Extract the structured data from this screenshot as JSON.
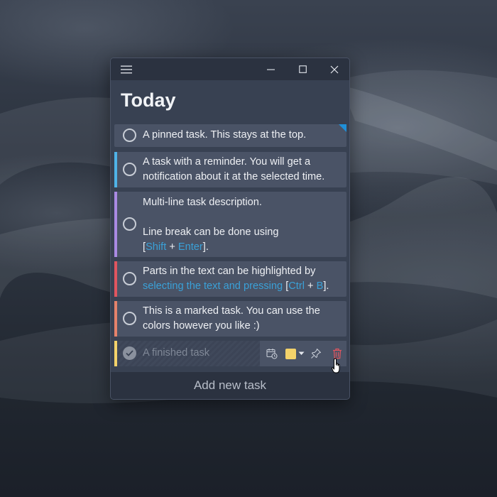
{
  "window": {
    "title": "Today",
    "add_task_label": "Add new task"
  },
  "tasks": [
    {
      "id": "pinned",
      "lines": [
        "A pinned task. This stays at the top."
      ],
      "pinned": true,
      "color": ""
    },
    {
      "id": "reminder",
      "lines": [
        "A task with a reminder. You will get a",
        "notification about it at the selected time."
      ],
      "color": "#4fb3e8"
    },
    {
      "id": "multiline",
      "line1": "Multi-line task description.",
      "line2": "Line break can be done using",
      "line3_open": "[",
      "line3_shift": "Shift",
      "line3_plus": " + ",
      "line3_enter": "Enter",
      "line3_close": "].",
      "color": "#a98ae3"
    },
    {
      "id": "highlight",
      "line1": "Parts in the text can be highlighted by",
      "line2_hl": "selecting the text and pressing",
      "line2_open": " [",
      "line2_ctrl": "Ctrl",
      "line2_plus": " + ",
      "line2_b": "B",
      "line2_close": "].",
      "color": "#e0555f"
    },
    {
      "id": "marked",
      "lines": [
        "This is a marked task. You can use the",
        "colors however you like :)"
      ],
      "color": "#e5826b"
    },
    {
      "id": "finished",
      "lines": [
        "A finished task"
      ],
      "color": "#f3d26a",
      "done": true
    }
  ],
  "icons": {
    "menu": "hamburger-menu-icon",
    "minimize": "minimize-icon",
    "maximize": "maximize-icon",
    "close": "close-icon",
    "reminder": "calendar-clock-icon",
    "color_swatch": "#f3d26a",
    "dropdown": "chevron-down-icon",
    "pin": "pin-icon",
    "delete": "trash-icon"
  }
}
